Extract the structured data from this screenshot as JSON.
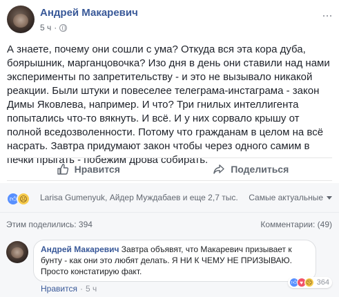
{
  "post": {
    "author": "Андрей Макаревич",
    "time": "5 ч",
    "privacy_icon": "globe-icon",
    "more_icon": "more-icon",
    "text": "А знаете, почему они сошли с ума? Откуда вся эта кора дуба, боярышник, марганцовочка? Изо дня в день они ставили над нами эксперименты по запретительству - и это не вызывало никакой реакции. Были штуки и повеселее телеграма-инстаграма - закон Димы Яковлева, например. И что? Три гнилых интеллигента попытались что-то вякнуть. И всё. И у них сорвало крышу от полной вседозволенности. Потому что гражданам в целом на всё насрать. Завтра придумают закон чтобы через одного самим в печки прыгать - побежим дрова собирать."
  },
  "actions": {
    "like_label": "Нравится",
    "share_label": "Поделиться"
  },
  "reactions": {
    "names": "Larisa Gumenyuk, Айдер Муждабаев и еще 2,7 тыс.",
    "sort_label": "Самые актуальные"
  },
  "stats": {
    "shares": "Этим поделились: 394",
    "comments": "Комментарии: (49)"
  },
  "comment": {
    "author": "Андрей Макаревич",
    "text": " Завтра объявят, что Макаревич призывает к бунту - как они это любят делать. Я НИ К ЧЕМУ НЕ ПРИЗЫВАЮ. Просто констатирую факт.",
    "like_label": "Нравится",
    "separator": "·",
    "time": "5 ч",
    "reaction_count": "364"
  },
  "colors": {
    "link": "#385898",
    "like": "#5890ff",
    "love": "#f25268",
    "sad": "#f7cb4d"
  }
}
